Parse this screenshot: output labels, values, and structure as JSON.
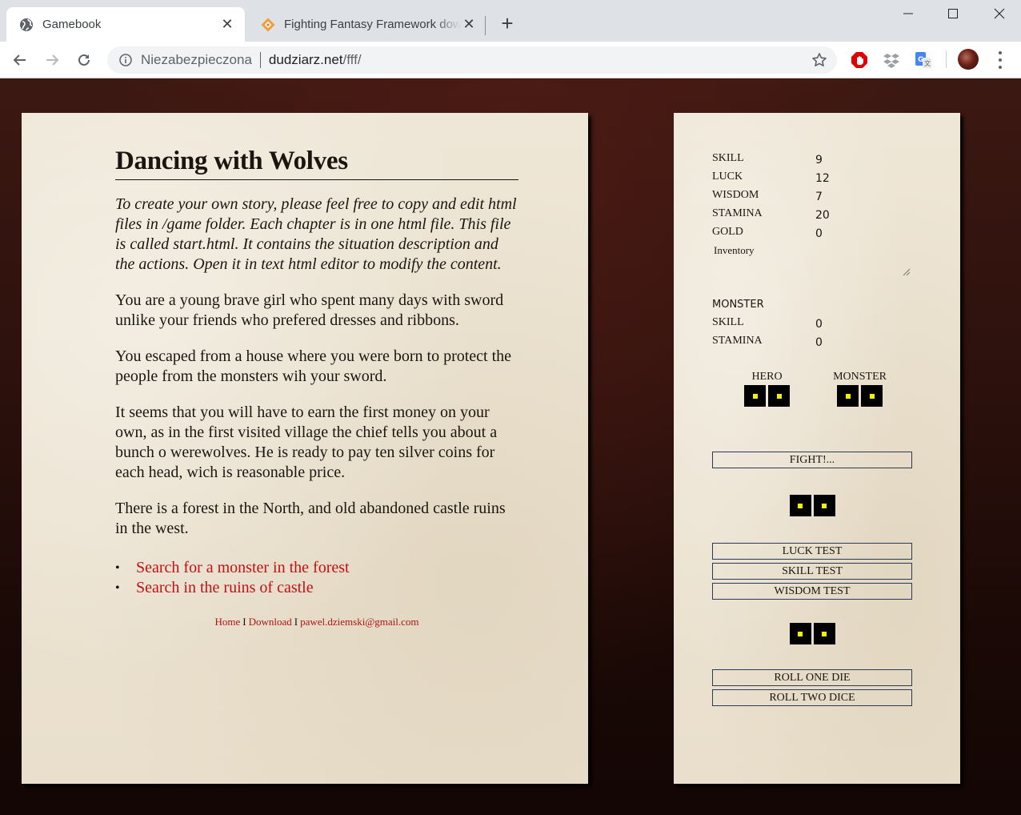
{
  "browser": {
    "tabs": [
      {
        "title": "Gamebook",
        "icon": "globe-icon",
        "active": true
      },
      {
        "title": "Fighting Fantasy Framework download",
        "icon": "diamond-logo-icon",
        "active": false
      }
    ],
    "new_tab_label": "+",
    "address": {
      "security_label": "Niezabezpieczona",
      "host": "dudziarz.net",
      "path": "/fff/"
    },
    "extensions": [
      "adblock-icon",
      "dropbox-icon",
      "google-translate-icon"
    ]
  },
  "story": {
    "title": "Dancing with Wolves",
    "intro": "To create your own story, please feel free to copy and edit html files in /game folder. Each chapter is in one html file. This file is called start.html. It contains the situation description and the actions. Open it in text html editor to modify the content.",
    "paragraphs": [
      "You are a young brave girl who spent many days with sword unlike your friends who prefered dresses and ribbons.",
      "You escaped from a house where you were born to protect the people from the monsters wih your sword.",
      "It seems that you will have to earn the first money on your own, as in the first visited village the chief tells you about a bunch o werewolves. He is ready to pay ten silver coins for each head, wich is reasonable price.",
      "There is a forest in the North, and old abandoned castle ruins in the west."
    ],
    "choices": [
      {
        "bullet": "•",
        "label": "Search for a monster in the forest"
      },
      {
        "bullet": "•",
        "label": "Search in the ruins of castle"
      }
    ],
    "footer": {
      "home": "Home",
      "separator": "I",
      "download": "Download",
      "email": "pawel.dziemski@gmail.com"
    }
  },
  "sheet": {
    "hero_stats": [
      {
        "label": "SKILL",
        "value": "9"
      },
      {
        "label": "LUCK",
        "value": "12"
      },
      {
        "label": "WISDOM",
        "value": "7"
      },
      {
        "label": "STAMINA",
        "value": "20"
      },
      {
        "label": "GOLD",
        "value": "0"
      }
    ],
    "inventory_placeholder": "Inventory",
    "monster_heading": "MONSTER",
    "monster_stats": [
      {
        "label": "SKILL",
        "value": "0"
      },
      {
        "label": "STAMINA",
        "value": "0"
      }
    ],
    "hero_dice_label": "HERO",
    "monster_dice_label": "MONSTER",
    "dice": {
      "hero": [
        1,
        1
      ],
      "monster": [
        1,
        1
      ],
      "test": [
        1,
        1
      ],
      "roll": [
        1,
        1
      ]
    },
    "buttons": {
      "fight": "FIGHT!...",
      "luck_test": "LUCK TEST",
      "skill_test": "SKILL TEST",
      "wisdom_test": "WISDOM TEST",
      "roll_one": "ROLL ONE DIE",
      "roll_two": "ROLL TWO DICE"
    },
    "colors": {
      "die_face": "#000000",
      "die_pip": "#f4f000",
      "button_border": "#2b3a5a",
      "link": "#c41014"
    }
  }
}
